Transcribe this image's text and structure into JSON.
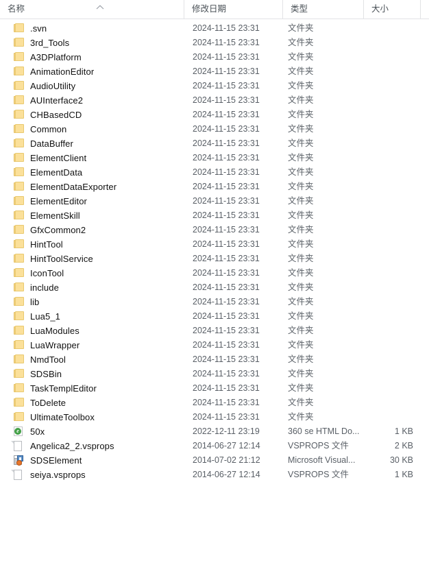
{
  "header": {
    "columns": [
      {
        "label": "名称",
        "key": "name"
      },
      {
        "label": "修改日期",
        "key": "date"
      },
      {
        "label": "类型",
        "key": "type"
      },
      {
        "label": "大小",
        "key": "size"
      }
    ],
    "sort": {
      "column": "名称",
      "direction": "ascending",
      "icon": "chevron-up-icon"
    }
  },
  "types": {
    "folder": "文件夹",
    "vsprops": "VSPROPS 文件",
    "html360": "360 se HTML Do...",
    "msvs": "Microsoft Visual..."
  },
  "rows": [
    {
      "name": ".svn",
      "date": "2024-11-15 23:31",
      "type": "文件夹",
      "size": "",
      "icon": "folder-icon"
    },
    {
      "name": "3rd_Tools",
      "date": "2024-11-15 23:31",
      "type": "文件夹",
      "size": "",
      "icon": "folder-icon"
    },
    {
      "name": "A3DPlatform",
      "date": "2024-11-15 23:31",
      "type": "文件夹",
      "size": "",
      "icon": "folder-icon"
    },
    {
      "name": "AnimationEditor",
      "date": "2024-11-15 23:31",
      "type": "文件夹",
      "size": "",
      "icon": "folder-icon"
    },
    {
      "name": "AudioUtility",
      "date": "2024-11-15 23:31",
      "type": "文件夹",
      "size": "",
      "icon": "folder-icon"
    },
    {
      "name": "AUInterface2",
      "date": "2024-11-15 23:31",
      "type": "文件夹",
      "size": "",
      "icon": "folder-icon"
    },
    {
      "name": "CHBasedCD",
      "date": "2024-11-15 23:31",
      "type": "文件夹",
      "size": "",
      "icon": "folder-icon"
    },
    {
      "name": "Common",
      "date": "2024-11-15 23:31",
      "type": "文件夹",
      "size": "",
      "icon": "folder-icon"
    },
    {
      "name": "DataBuffer",
      "date": "2024-11-15 23:31",
      "type": "文件夹",
      "size": "",
      "icon": "folder-icon"
    },
    {
      "name": "ElementClient",
      "date": "2024-11-15 23:31",
      "type": "文件夹",
      "size": "",
      "icon": "folder-icon"
    },
    {
      "name": "ElementData",
      "date": "2024-11-15 23:31",
      "type": "文件夹",
      "size": "",
      "icon": "folder-icon"
    },
    {
      "name": "ElementDataExporter",
      "date": "2024-11-15 23:31",
      "type": "文件夹",
      "size": "",
      "icon": "folder-icon"
    },
    {
      "name": "ElementEditor",
      "date": "2024-11-15 23:31",
      "type": "文件夹",
      "size": "",
      "icon": "folder-icon"
    },
    {
      "name": "ElementSkill",
      "date": "2024-11-15 23:31",
      "type": "文件夹",
      "size": "",
      "icon": "folder-icon"
    },
    {
      "name": "GfxCommon2",
      "date": "2024-11-15 23:31",
      "type": "文件夹",
      "size": "",
      "icon": "folder-icon"
    },
    {
      "name": "HintTool",
      "date": "2024-11-15 23:31",
      "type": "文件夹",
      "size": "",
      "icon": "folder-icon"
    },
    {
      "name": "HintToolService",
      "date": "2024-11-15 23:31",
      "type": "文件夹",
      "size": "",
      "icon": "folder-icon"
    },
    {
      "name": "IconTool",
      "date": "2024-11-15 23:31",
      "type": "文件夹",
      "size": "",
      "icon": "folder-icon"
    },
    {
      "name": "include",
      "date": "2024-11-15 23:31",
      "type": "文件夹",
      "size": "",
      "icon": "folder-icon"
    },
    {
      "name": "lib",
      "date": "2024-11-15 23:31",
      "type": "文件夹",
      "size": "",
      "icon": "folder-icon"
    },
    {
      "name": "Lua5_1",
      "date": "2024-11-15 23:31",
      "type": "文件夹",
      "size": "",
      "icon": "folder-icon"
    },
    {
      "name": "LuaModules",
      "date": "2024-11-15 23:31",
      "type": "文件夹",
      "size": "",
      "icon": "folder-icon"
    },
    {
      "name": "LuaWrapper",
      "date": "2024-11-15 23:31",
      "type": "文件夹",
      "size": "",
      "icon": "folder-icon"
    },
    {
      "name": "NmdTool",
      "date": "2024-11-15 23:31",
      "type": "文件夹",
      "size": "",
      "icon": "folder-icon"
    },
    {
      "name": "SDSBin",
      "date": "2024-11-15 23:31",
      "type": "文件夹",
      "size": "",
      "icon": "folder-icon"
    },
    {
      "name": "TaskTemplEditor",
      "date": "2024-11-15 23:31",
      "type": "文件夹",
      "size": "",
      "icon": "folder-icon"
    },
    {
      "name": "ToDelete",
      "date": "2024-11-15 23:31",
      "type": "文件夹",
      "size": "",
      "icon": "folder-icon"
    },
    {
      "name": "UltimateToolbox",
      "date": "2024-11-15 23:31",
      "type": "文件夹",
      "size": "",
      "icon": "folder-icon"
    },
    {
      "name": "50x",
      "date": "2022-12-11 23:19",
      "type": "360 se HTML Do...",
      "size": "1 KB",
      "icon": "html-document-icon"
    },
    {
      "name": "Angelica2_2.vsprops",
      "date": "2014-06-27 12:14",
      "type": "VSPROPS 文件",
      "size": "2 KB",
      "icon": "document-icon"
    },
    {
      "name": "SDSElement",
      "date": "2014-07-02 21:12",
      "type": "Microsoft Visual...",
      "size": "30 KB",
      "icon": "visual-studio-icon"
    },
    {
      "name": "seiya.vsprops",
      "date": "2014-06-27 12:14",
      "type": "VSPROPS 文件",
      "size": "1 KB",
      "icon": "document-icon"
    }
  ]
}
